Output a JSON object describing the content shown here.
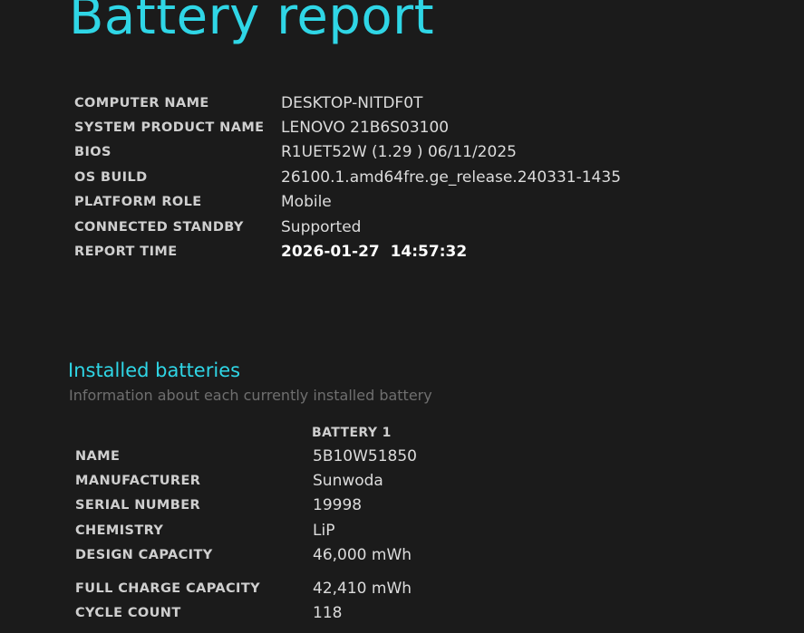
{
  "header": {
    "title": "Battery report"
  },
  "system_info": [
    {
      "label": "COMPUTER NAME",
      "value": "DESKTOP-NITDF0T"
    },
    {
      "label": "SYSTEM PRODUCT NAME",
      "value": "LENOVO 21B6S03100"
    },
    {
      "label": "BIOS",
      "value": "R1UET52W (1.29 ) 06/11/2025"
    },
    {
      "label": "OS BUILD",
      "value": "26100.1.amd64fre.ge_release.240331-1435"
    },
    {
      "label": "PLATFORM ROLE",
      "value": "Mobile"
    },
    {
      "label": "CONNECTED STANDBY",
      "value": "Supported"
    },
    {
      "label": "REPORT TIME",
      "value": "2026-01-27  14:57:32"
    }
  ],
  "installed_batteries": {
    "title": "Installed batteries",
    "subtitle": "Information about each currently installed battery",
    "column_header": "BATTERY 1",
    "rows": [
      {
        "label": "NAME",
        "value": "5B10W51850"
      },
      {
        "label": "MANUFACTURER",
        "value": "Sunwoda"
      },
      {
        "label": "SERIAL NUMBER",
        "value": "19998"
      },
      {
        "label": "CHEMISTRY",
        "value": "LiP"
      },
      {
        "label": "DESIGN CAPACITY",
        "value": "46,000 mWh"
      },
      {
        "label": "FULL CHARGE CAPACITY",
        "value": "42,410 mWh"
      },
      {
        "label": "CYCLE COUNT",
        "value": "118"
      }
    ]
  }
}
